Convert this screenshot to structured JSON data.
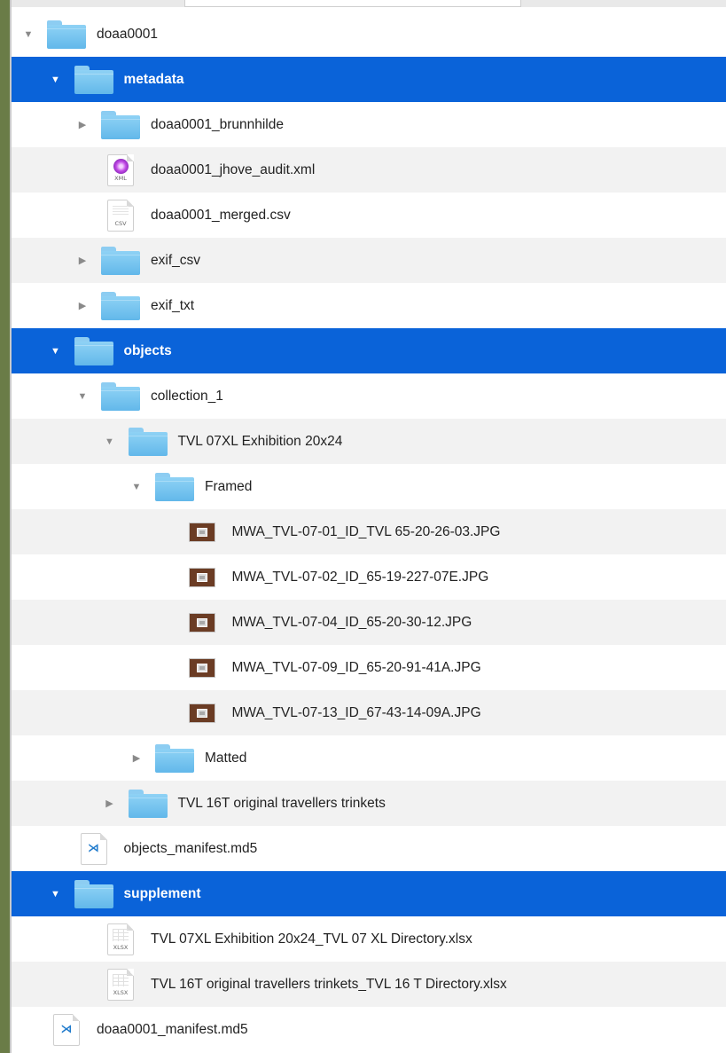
{
  "rows": [
    {
      "label": "doaa0001",
      "kind": "folder",
      "expander": "expanded",
      "level": 0,
      "selected": false
    },
    {
      "label": "metadata",
      "kind": "folder",
      "expander": "expanded",
      "level": 1,
      "selected": true
    },
    {
      "label": "doaa0001_brunnhilde",
      "kind": "folder",
      "expander": "collapsed",
      "level": 2,
      "selected": false
    },
    {
      "label": "doaa0001_jhove_audit.xml",
      "kind": "xml",
      "icon_tag": "XML",
      "expander": "none",
      "level": 2,
      "selected": false
    },
    {
      "label": "doaa0001_merged.csv",
      "kind": "csv",
      "icon_tag": "CSV",
      "expander": "none",
      "level": 2,
      "selected": false
    },
    {
      "label": "exif_csv",
      "kind": "folder",
      "expander": "collapsed",
      "level": 2,
      "selected": false
    },
    {
      "label": "exif_txt",
      "kind": "folder",
      "expander": "collapsed",
      "level": 2,
      "selected": false
    },
    {
      "label": "objects",
      "kind": "folder",
      "expander": "expanded",
      "level": 1,
      "selected": true
    },
    {
      "label": "collection_1",
      "kind": "folder",
      "expander": "expanded",
      "level": 2,
      "selected": false
    },
    {
      "label": "TVL 07XL Exhibition 20x24",
      "kind": "folder",
      "expander": "expanded",
      "level": 3,
      "selected": false
    },
    {
      "label": "Framed",
      "kind": "folder",
      "expander": "expanded",
      "level": 4,
      "selected": false
    },
    {
      "label": "MWA_TVL-07-01_ID_TVL 65-20-26-03.JPG",
      "kind": "jpg",
      "expander": "none",
      "level": 5,
      "selected": false
    },
    {
      "label": "MWA_TVL-07-02_ID_65-19-227-07E.JPG",
      "kind": "jpg",
      "expander": "none",
      "level": 5,
      "selected": false
    },
    {
      "label": "MWA_TVL-07-04_ID_65-20-30-12.JPG",
      "kind": "jpg",
      "expander": "none",
      "level": 5,
      "selected": false
    },
    {
      "label": "MWA_TVL-07-09_ID_65-20-91-41A.JPG",
      "kind": "jpg",
      "expander": "none",
      "level": 5,
      "selected": false
    },
    {
      "label": "MWA_TVL-07-13_ID_67-43-14-09A.JPG",
      "kind": "jpg",
      "expander": "none",
      "level": 5,
      "selected": false
    },
    {
      "label": "Matted",
      "kind": "folder",
      "expander": "collapsed",
      "level": 4,
      "selected": false
    },
    {
      "label": "TVL 16T original travellers trinkets",
      "kind": "folder",
      "expander": "collapsed",
      "level": 3,
      "selected": false
    },
    {
      "label": "objects_manifest.md5",
      "kind": "md5",
      "expander": "none",
      "level": 1,
      "selected": false
    },
    {
      "label": "supplement",
      "kind": "folder",
      "expander": "expanded",
      "level": 1,
      "selected": true
    },
    {
      "label": "TVL 07XL Exhibition 20x24_TVL 07 XL Directory.xlsx",
      "kind": "xlsx",
      "icon_tag": "XLSX",
      "expander": "none",
      "level": 2,
      "selected": false
    },
    {
      "label": "TVL 16T original travellers trinkets_TVL 16 T Directory.xlsx",
      "kind": "xlsx2",
      "icon_tag": "XLSX",
      "expander": "none",
      "level": 2,
      "selected": false
    },
    {
      "label": "doaa0001_manifest.md5",
      "kind": "md5",
      "expander": "none",
      "level": 0,
      "selected": false
    }
  ],
  "icons": {
    "expanded": "▼",
    "collapsed": "▶"
  },
  "colors": {
    "selection": "#0a63d9",
    "alt_row": "#f2f2f2",
    "folder": "#62b8ea",
    "side_strip": "#6a7c47"
  }
}
